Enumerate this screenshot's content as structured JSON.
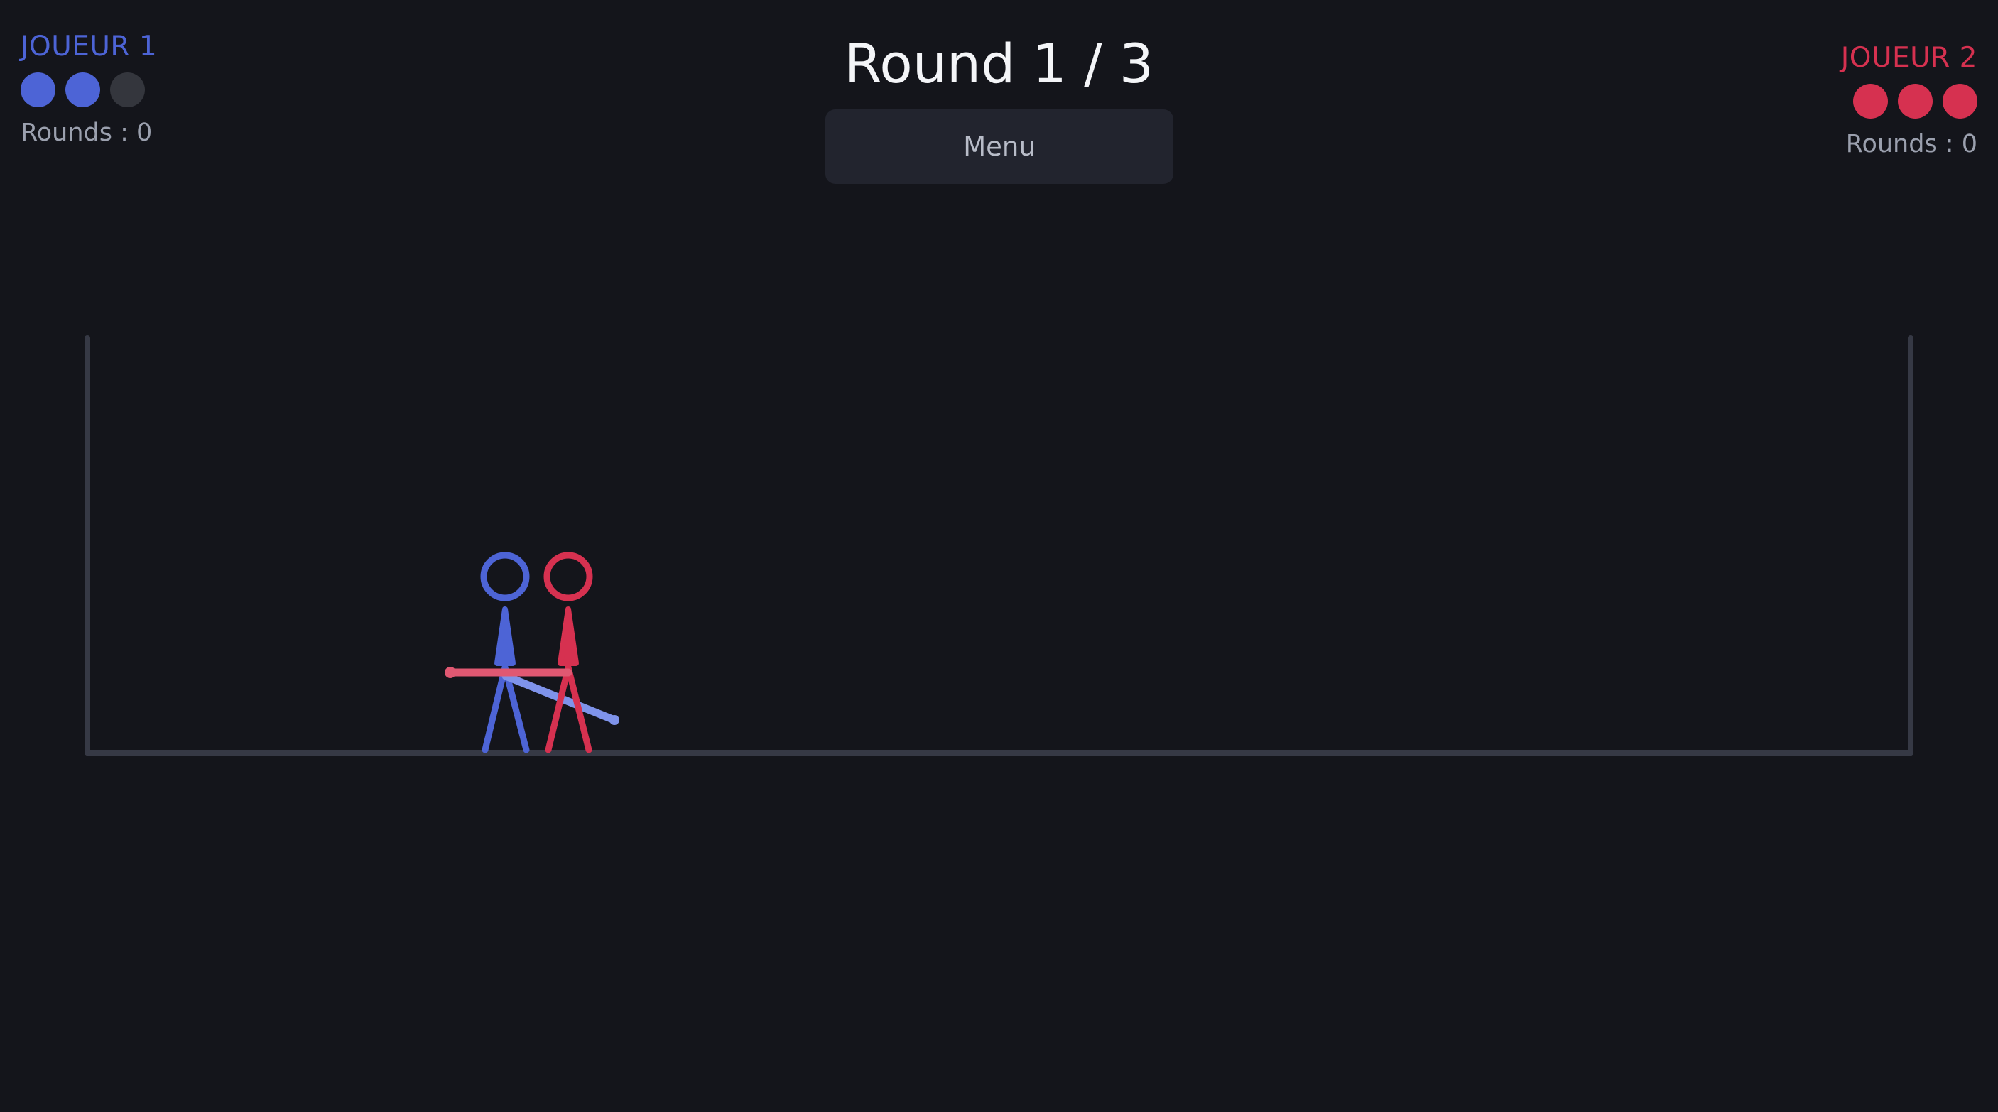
{
  "player1": {
    "name": "JOUEUR 1",
    "color": "#4d64d6",
    "lives_total": 3,
    "lives_remaining": 2,
    "rounds_label": "Rounds : 0"
  },
  "player2": {
    "name": "JOUEUR 2",
    "color": "#d63150",
    "lives_total": 3,
    "lives_remaining": 3,
    "rounds_label": "Rounds : 0"
  },
  "round_title": "Round 1 / 3",
  "menu_label": "Menu",
  "colors": {
    "background": "#14151b",
    "arena_wall": "#363945",
    "empty_life": "#34363d",
    "player1_weapon": "#7f93ea",
    "player2_weapon": "#e05872"
  }
}
